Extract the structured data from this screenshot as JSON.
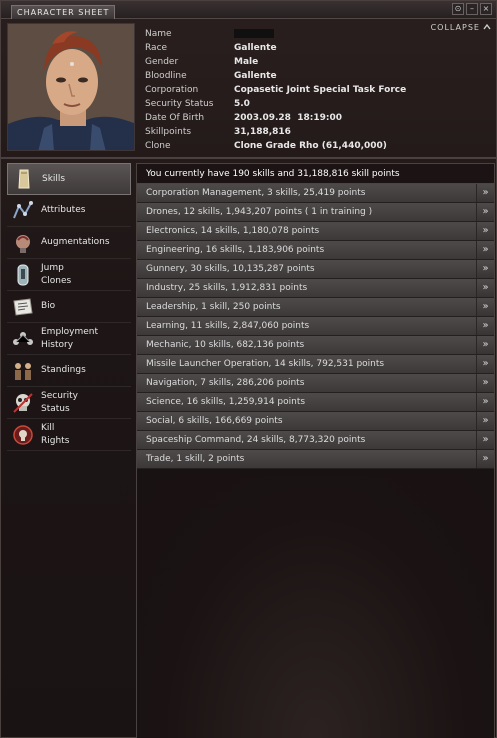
{
  "window": {
    "title": "CHARACTER SHEET",
    "collapse_label": "COLLAPSE",
    "buttons": [
      "⊙",
      "–",
      "×"
    ]
  },
  "character": {
    "fields": [
      {
        "label": "Name",
        "value": ""
      },
      {
        "label": "Race",
        "value": "Gallente"
      },
      {
        "label": "Gender",
        "value": "Male"
      },
      {
        "label": "Bloodline",
        "value": "Gallente"
      },
      {
        "label": "Corporation",
        "value": "Copasetic Joint Special Task Force"
      },
      {
        "label": "Security Status",
        "value": "5.0"
      },
      {
        "label": "Date Of Birth",
        "value": "2003.09.28  18:19:00"
      },
      {
        "label": "Skillpoints",
        "value": "31,188,816"
      },
      {
        "label": "Clone",
        "value": "Clone Grade Rho (61,440,000)"
      }
    ]
  },
  "sidebar": {
    "items": [
      {
        "label": "Skills",
        "icon": "skills-icon",
        "active": true
      },
      {
        "label": "Attributes",
        "icon": "attributes-icon"
      },
      {
        "label": "Augmentations",
        "icon": "augmentations-icon"
      },
      {
        "label": "Jump\nClones",
        "icon": "jump-clones-icon"
      },
      {
        "label": "Bio",
        "icon": "bio-icon"
      },
      {
        "label": "Employment\nHistory",
        "icon": "employment-history-icon"
      },
      {
        "label": "Standings",
        "icon": "standings-icon"
      },
      {
        "label": "Security\nStatus",
        "icon": "security-status-icon"
      },
      {
        "label": "Kill\nRights",
        "icon": "kill-rights-icon"
      }
    ]
  },
  "skills": {
    "summary": "You currently have 190 skills and 31,188,816 skill points",
    "groups": [
      "Corporation Management, 3 skills, 25,419 points",
      "Drones, 12 skills, 1,943,207 points ( 1 in training )",
      "Electronics, 14 skills, 1,180,078 points",
      "Engineering, 16 skills, 1,183,906 points",
      "Gunnery, 30 skills, 10,135,287 points",
      "Industry, 25 skills, 1,912,831 points",
      "Leadership, 1 skill, 250 points",
      "Learning, 11 skills, 2,847,060 points",
      "Mechanic, 10 skills, 682,136 points",
      "Missile Launcher Operation, 14 skills, 792,531 points",
      "Navigation, 7 skills, 286,206 points",
      "Science, 16 skills, 1,259,914 points",
      "Social, 6 skills, 166,669 points",
      "Spaceship Command, 24 skills, 8,773,320 points",
      "Trade, 1 skill, 2 points"
    ],
    "expand_glyph": "»"
  }
}
